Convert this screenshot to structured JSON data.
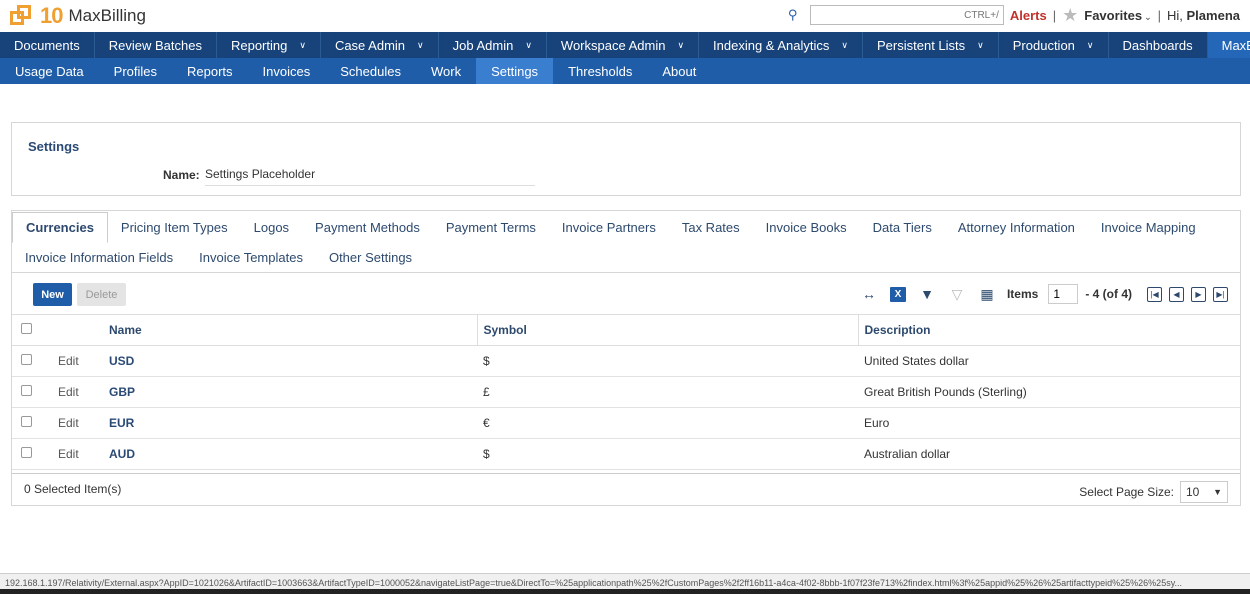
{
  "header": {
    "logo_number": "10",
    "app_name": "MaxBilling",
    "search_placeholder": "CTRL+/",
    "alerts_label": "Alerts",
    "separator": "|",
    "favorites_label": "Favorites",
    "greeting": "Hi,",
    "user_name": "Plamena"
  },
  "nav_primary": [
    {
      "label": "Documents",
      "dropdown": false
    },
    {
      "label": "Review Batches",
      "dropdown": false
    },
    {
      "label": "Reporting",
      "dropdown": true
    },
    {
      "label": "Case Admin",
      "dropdown": true
    },
    {
      "label": "Job Admin",
      "dropdown": true
    },
    {
      "label": "Workspace Admin",
      "dropdown": true
    },
    {
      "label": "Indexing & Analytics",
      "dropdown": true
    },
    {
      "label": "Persistent Lists",
      "dropdown": true
    },
    {
      "label": "Production",
      "dropdown": true
    },
    {
      "label": "Dashboards",
      "dropdown": false
    },
    {
      "label": "MaxBilling",
      "dropdown": false,
      "active": true
    }
  ],
  "nav_secondary": [
    {
      "label": "Usage Data"
    },
    {
      "label": "Profiles"
    },
    {
      "label": "Reports"
    },
    {
      "label": "Invoices"
    },
    {
      "label": "Schedules"
    },
    {
      "label": "Work"
    },
    {
      "label": "Settings",
      "active": true
    },
    {
      "label": "Thresholds"
    },
    {
      "label": "About"
    }
  ],
  "settings": {
    "title": "Settings",
    "name_label": "Name:",
    "name_value": "Settings Placeholder"
  },
  "tabs_row1": [
    {
      "label": "Currencies",
      "active": true
    },
    {
      "label": "Pricing Item Types"
    },
    {
      "label": "Logos"
    },
    {
      "label": "Payment Methods"
    },
    {
      "label": "Payment Terms"
    },
    {
      "label": "Invoice Partners"
    },
    {
      "label": "Tax Rates"
    },
    {
      "label": "Invoice Books"
    },
    {
      "label": "Data Tiers"
    },
    {
      "label": "Attorney Information"
    },
    {
      "label": "Invoice Mapping"
    }
  ],
  "tabs_row2": [
    {
      "label": "Invoice Information Fields"
    },
    {
      "label": "Invoice Templates"
    },
    {
      "label": "Other Settings"
    }
  ],
  "toolbar": {
    "new_label": "New",
    "delete_label": "Delete",
    "items_label": "Items",
    "page_value": "1",
    "range_text": "- 4 (of 4)"
  },
  "table": {
    "columns": [
      "Name",
      "Symbol",
      "Description"
    ],
    "edit_label": "Edit",
    "rows": [
      {
        "name": "USD",
        "symbol": "$",
        "description": "United States dollar"
      },
      {
        "name": "GBP",
        "symbol": "£",
        "description": "Great British Pounds (Sterling)"
      },
      {
        "name": "EUR",
        "symbol": "€",
        "description": "Euro"
      },
      {
        "name": "AUD",
        "symbol": "$",
        "description": "Australian dollar"
      }
    ]
  },
  "footer": {
    "selected_text": "0  Selected Item(s)",
    "page_size_label": "Select Page Size:",
    "page_size_value": "10"
  },
  "status_url": "192.168.1.197/Relativity/External.aspx?AppID=1021026&ArtifactID=1003663&ArtifactTypeID=1000052&navigateListPage=true&DirectTo=%25applicationpath%25%2fCustomPages%2f2ff16b11-a4ca-4f02-8bbb-1f07f23fe713%2findex.html%3f%25appid%25%26%25artifacttypeid%25%26%25sy...",
  "colors": {
    "nav_primary_bg": "#17427a",
    "nav_secondary_bg": "#1f5da8",
    "logo_accent": "#f0a030",
    "alerts": "#c0312b"
  }
}
